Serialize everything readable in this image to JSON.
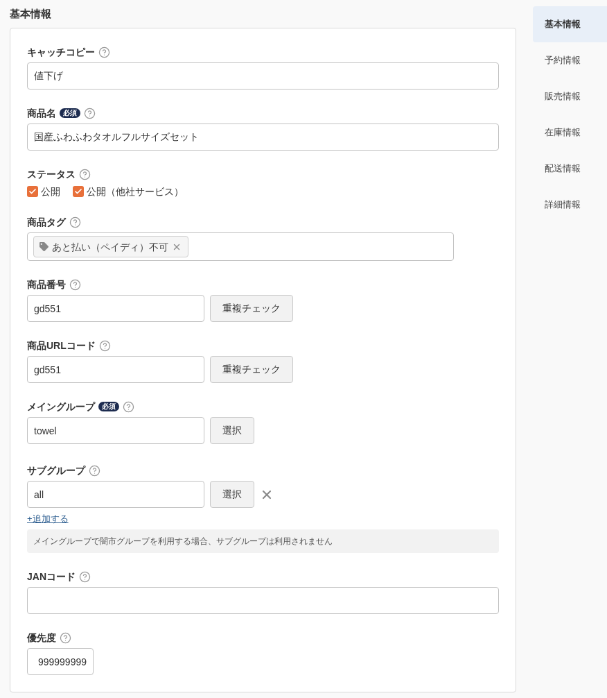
{
  "section_title": "基本情報",
  "fields": [
    {
      "kind": "text",
      "label": "キャッチコピー",
      "value": "値下げ"
    },
    {
      "kind": "text",
      "label": "商品名",
      "badge": "必須",
      "value": "国産ふわふわタオルフルサイズセット"
    },
    {
      "kind": "checkboxes",
      "label": "ステータス",
      "options": [
        {
          "label": "公開",
          "checked": true
        },
        {
          "label": "公開（他社サービス）",
          "checked": true
        }
      ]
    },
    {
      "kind": "tags",
      "label": "商品タグ",
      "tags": [
        "あと払い（ペイディ）不可"
      ]
    },
    {
      "kind": "text_button",
      "label": "商品番号",
      "value": "gd551",
      "button": "重複チェック",
      "removable": false
    },
    {
      "kind": "text_button",
      "label": "商品URLコード",
      "value": "gd551",
      "button": "重複チェック",
      "removable": false
    },
    {
      "kind": "text_button",
      "label": "メイングループ",
      "badge": "必須",
      "value": "towel",
      "button": "選択",
      "removable": false
    },
    {
      "kind": "text_button",
      "label": "サブグループ",
      "value": "all",
      "button": "選択",
      "removable": true,
      "add_link": "+追加する",
      "note": "メイングループで闇市グループを利用する場合、サブグループは利用されません"
    },
    {
      "kind": "text",
      "label": "JANコード"
    },
    {
      "kind": "number",
      "label": "優先度",
      "value": "999999999"
    }
  ],
  "nav": [
    {
      "label": "基本情報",
      "selected": true
    },
    {
      "label": "予約情報",
      "selected": false
    },
    {
      "label": "販売情報",
      "selected": false
    },
    {
      "label": "在庫情報",
      "selected": false
    },
    {
      "label": "配送情報",
      "selected": false
    },
    {
      "label": "詳細情報",
      "selected": false
    }
  ]
}
